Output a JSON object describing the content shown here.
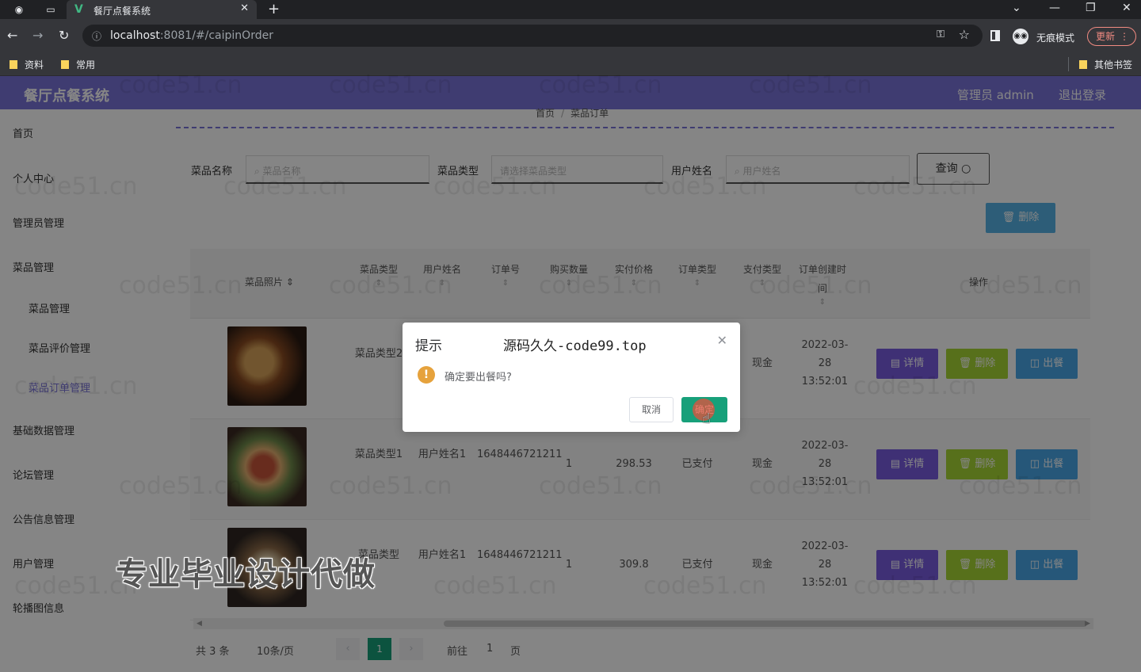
{
  "browser": {
    "tab_title": "餐厅点餐系统",
    "url_host": "localhost",
    "url_rest": ":8081/#/caipinOrder",
    "incognito_label": "无痕模式",
    "update_label": "更新",
    "bookmarks": [
      "资料",
      "常用"
    ],
    "other_bookmarks": "其他书签"
  },
  "app": {
    "brand": "餐厅点餐系统",
    "user_label": "管理员 admin",
    "logout": "退出登录",
    "breadcrumb": [
      "首页",
      "菜品订单"
    ]
  },
  "sidebar": {
    "items": [
      {
        "label": "首页",
        "level": 1
      },
      {
        "label": "个人中心",
        "level": 1
      },
      {
        "label": "管理员管理",
        "level": 1
      },
      {
        "label": "菜品管理",
        "level": 1
      },
      {
        "label": "菜品管理",
        "level": 2
      },
      {
        "label": "菜品评价管理",
        "level": 2
      },
      {
        "label": "菜品订单管理",
        "level": 2,
        "active": true
      },
      {
        "label": "基础数据管理",
        "level": 1
      },
      {
        "label": "论坛管理",
        "level": 1
      },
      {
        "label": "公告信息管理",
        "level": 1
      },
      {
        "label": "用户管理",
        "level": 1
      },
      {
        "label": "轮播图信息",
        "level": 1
      }
    ]
  },
  "filters": {
    "name_label": "菜品名称",
    "name_placeholder": "菜品名称",
    "type_label": "菜品类型",
    "type_placeholder": "请选择菜品类型",
    "user_label": "用户姓名",
    "user_placeholder": "用户姓名",
    "query_button": "查询",
    "delete_button": "删除"
  },
  "table": {
    "headers": {
      "photo": "菜品照片",
      "type": "菜品类型",
      "user": "用户姓名",
      "order_no": "订单号",
      "qty": "购买数量",
      "price": "实付价格",
      "order_type": "订单类型",
      "pay_type": "支付类型",
      "created": "订单创建时间",
      "actions": "操作"
    },
    "actions": {
      "detail": "详情",
      "delete": "删除",
      "serve": "出餐"
    },
    "rows": [
      {
        "type": "菜品类型2",
        "user": "",
        "order_no": "",
        "qty": "",
        "price": "",
        "order_type": "",
        "pay_type": "现金",
        "created": "2022-03-28 13:52:01"
      },
      {
        "type": "菜品类型1",
        "user": "用户姓名1",
        "order_no": "1648446721211",
        "qty": "1",
        "price": "298.53",
        "order_type": "已支付",
        "pay_type": "现金",
        "created": "2022-03-28 13:52:01"
      },
      {
        "type": "菜品类型",
        "user": "用户姓名1",
        "order_no": "1648446721211",
        "qty": "1",
        "price": "309.8",
        "order_type": "已支付",
        "pay_type": "现金",
        "created": "2022-03-28 13:52:01"
      }
    ]
  },
  "pagination": {
    "total": "共 3 条",
    "page_size": "10条/页",
    "current_page": "1",
    "goto_label": "前往",
    "goto_value": "1",
    "page_suffix": "页"
  },
  "dialog": {
    "title": "提示",
    "site": "源码久久-code99.top",
    "message": "确定要出餐吗?",
    "cancel": "取消",
    "confirm": "确定"
  },
  "overlay_text": "专业毕业设计代做",
  "watermark": "code51.cn",
  "colors": {
    "header": "#7a73d9",
    "primary": "#17a07a",
    "detail": "#7a5ce0",
    "delete": "#a8d635",
    "serve": "#4aa8e8",
    "warning": "#e6a23c"
  }
}
